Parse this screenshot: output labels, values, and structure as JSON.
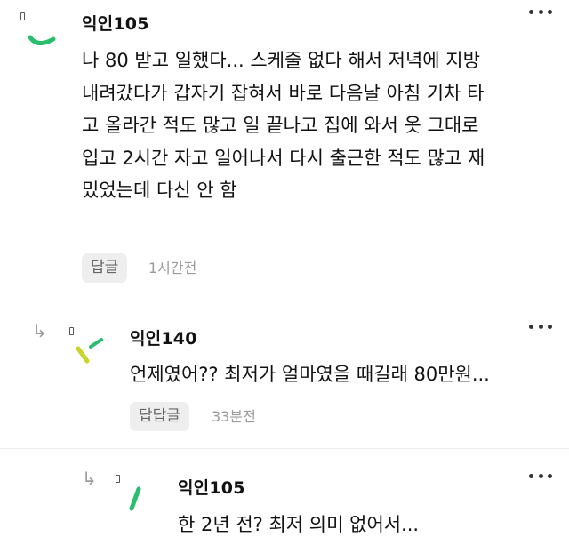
{
  "comments": [
    {
      "author": "익인105",
      "lines": [
        "나 80 받고 일했다... 스케줄 없다 해서 저녁에 지방",
        "내려갔다가 갑자기 잡혀서 바로 다음날 아침 기차 타",
        "고 올라간 적도 많고 일 끝나고 집에 와서 옷 그대로",
        "입고 2시간 자고 일어나서 다시 출근한 적도 많고 재",
        "밌었는데 다신 안 함"
      ],
      "reply_label": "답글",
      "time": "1시간전",
      "avatar_color": "#2bbd6e"
    },
    {
      "author": "익인140",
      "text": "언제였어?? 최저가 얼마였을 때길래 80만원...",
      "reply_label": "답답글",
      "time": "33분전",
      "avatar_colors": [
        "#c9d42a",
        "#2bbd6e"
      ]
    },
    {
      "author": "익인105",
      "text": "한 2년 전? 최저 의미 없어서...",
      "avatar_color": "#2bbd6e"
    }
  ],
  "icons": {
    "more": "more-dots-icon",
    "reply": "reply-arrow-icon",
    "avatar": "avatar-icon"
  }
}
